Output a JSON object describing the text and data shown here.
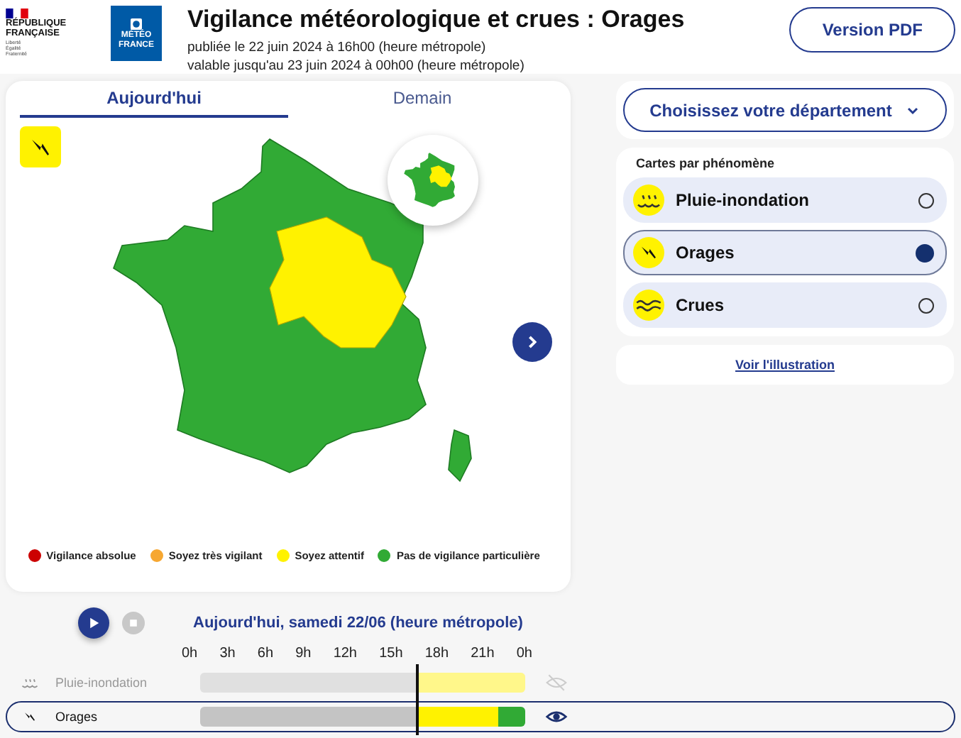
{
  "header": {
    "republic_logo": {
      "lines": [
        "RÉPUBLIQUE",
        "FRANÇAISE"
      ],
      "motto": "Liberté Égalité Fraternité"
    },
    "meteo_logo": {
      "lines": [
        "MÉTÉO",
        "FRANCE"
      ]
    },
    "title": "Vigilance météorologique et crues : Orages",
    "published": "publiée le 22 juin 2024 à 16h00 (heure métropole)",
    "valid": "valable jusqu'au 23 juin 2024 à 00h00 (heure métropole)",
    "pdf_button": "Version PDF"
  },
  "map_card": {
    "tabs": [
      {
        "label": "Aujourd'hui",
        "selected": true
      },
      {
        "label": "Demain",
        "selected": false
      }
    ],
    "legend": [
      {
        "label": "Vigilance absolue",
        "color": "#cc0000"
      },
      {
        "label": "Soyez très vigilant",
        "color": "#f6a731"
      },
      {
        "label": "Soyez attentif",
        "color": "#fff200"
      },
      {
        "label": "Pas de vigilance particulière",
        "color": "#31aa35"
      }
    ]
  },
  "department_select": {
    "label": "Choisissez votre département"
  },
  "phenomena": {
    "title": "Cartes par phénomène",
    "items": [
      {
        "label": "Pluie-inondation",
        "kind": "rain",
        "selected": false
      },
      {
        "label": "Orages",
        "kind": "storm",
        "selected": true
      },
      {
        "label": "Crues",
        "kind": "flood",
        "selected": false
      }
    ],
    "link": "Voir l'illustration"
  },
  "timeline": {
    "title": "Aujourd'hui, samedi 22/06 (heure métropole)",
    "hours": [
      "0h",
      "3h",
      "6h",
      "9h",
      "12h",
      "15h",
      "18h",
      "21h",
      "0h"
    ],
    "rows": [
      {
        "label": "Pluie-inondation",
        "kind": "rain",
        "visible": false,
        "selected": false,
        "slots": [
          {
            "color": "#e0e0e0",
            "now": false
          },
          {
            "color": "#e0e0e0",
            "now": false
          },
          {
            "color": "#e0e0e0",
            "now": false
          },
          {
            "color": "#e0e0e0",
            "now": false
          },
          {
            "color": "#e0e0e0",
            "now": false
          },
          {
            "color": "#e0e0e0",
            "now": false
          },
          {
            "color": "#e0e0e0",
            "now": false
          },
          {
            "color": "#e0e0e0",
            "now": false
          },
          {
            "color": "#e0e0e0",
            "now": false
          },
          {
            "color": "#e0e0e0",
            "now": false
          },
          {
            "color": "#e0e0e0",
            "now": false
          },
          {
            "color": "#e0e0e0",
            "now": false
          },
          {
            "color": "#e0e0e0",
            "now": false
          },
          {
            "color": "#e0e0e0",
            "now": false
          },
          {
            "color": "#e0e0e0",
            "now": false
          },
          {
            "color": "#e0e0e0",
            "now": false
          },
          {
            "color": "#fff78a",
            "now": true
          },
          {
            "color": "#fff78a",
            "now": false
          },
          {
            "color": "#fff78a",
            "now": false
          },
          {
            "color": "#fff78a",
            "now": false
          },
          {
            "color": "#fff78a",
            "now": false
          },
          {
            "color": "#fff78a",
            "now": false
          },
          {
            "color": "#fff78a",
            "now": false
          },
          {
            "color": "#fff78a",
            "now": false
          }
        ]
      },
      {
        "label": "Orages",
        "kind": "storm",
        "visible": true,
        "selected": true,
        "slots": [
          {
            "color": "#c4c4c4",
            "now": false
          },
          {
            "color": "#c4c4c4",
            "now": false
          },
          {
            "color": "#c4c4c4",
            "now": false
          },
          {
            "color": "#c4c4c4",
            "now": false
          },
          {
            "color": "#c4c4c4",
            "now": false
          },
          {
            "color": "#c4c4c4",
            "now": false
          },
          {
            "color": "#c4c4c4",
            "now": false
          },
          {
            "color": "#c4c4c4",
            "now": false
          },
          {
            "color": "#c4c4c4",
            "now": false
          },
          {
            "color": "#c4c4c4",
            "now": false
          },
          {
            "color": "#c4c4c4",
            "now": false
          },
          {
            "color": "#c4c4c4",
            "now": false
          },
          {
            "color": "#c4c4c4",
            "now": false
          },
          {
            "color": "#c4c4c4",
            "now": false
          },
          {
            "color": "#c4c4c4",
            "now": false
          },
          {
            "color": "#c4c4c4",
            "now": false
          },
          {
            "color": "#fff200",
            "now": true
          },
          {
            "color": "#fff200",
            "now": false
          },
          {
            "color": "#fff200",
            "now": false
          },
          {
            "color": "#fff200",
            "now": false
          },
          {
            "color": "#fff200",
            "now": false
          },
          {
            "color": "#fff200",
            "now": false
          },
          {
            "color": "#31aa35",
            "now": false
          },
          {
            "color": "#31aa35",
            "now": false
          }
        ]
      }
    ]
  }
}
